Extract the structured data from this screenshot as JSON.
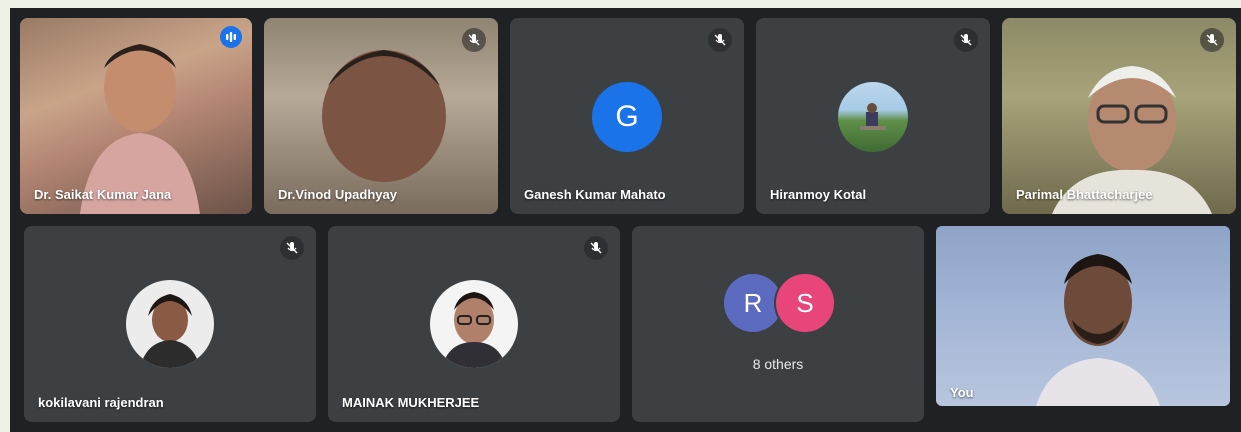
{
  "colors": {
    "tile": "#3c4043",
    "stage": "#202124",
    "active_border": "#8ab4f8",
    "speaking_badge": "#1a73e8",
    "letter_g": "#1a73e8",
    "letter_r": "#5c6bc0",
    "letter_s": "#e8457a"
  },
  "participants": [
    {
      "name": "Dr. Saikat Kumar Jana",
      "mic": "speaking-icon"
    },
    {
      "name": "Dr.Vinod Upadhyay",
      "mic": "mic-off-icon"
    },
    {
      "name": "Ganesh Kumar Mahato",
      "mic": "mic-off-icon",
      "initial": "G"
    },
    {
      "name": "Hiranmoy Kotal",
      "mic": "mic-off-icon"
    },
    {
      "name": "Parimal Bhattacharjee",
      "mic": "mic-off-icon"
    },
    {
      "name": "kokilavani rajendran",
      "mic": "mic-off-icon"
    },
    {
      "name": "MAINAK MUKHERJEE",
      "mic": "mic-off-icon"
    },
    {
      "name": "You"
    }
  ],
  "others": {
    "initials": [
      "R",
      "S"
    ],
    "label": "8 others"
  }
}
